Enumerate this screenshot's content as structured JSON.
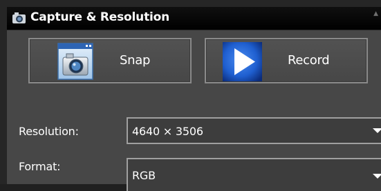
{
  "panel": {
    "title": "Capture & Resolution",
    "header_icon": "camera-icon",
    "scroll_indicator": "▲"
  },
  "buttons": {
    "snap": {
      "label": "Snap",
      "icon": "snapshot-window-camera-icon"
    },
    "record": {
      "label": "Record",
      "icon": "play-icon"
    }
  },
  "resolution": {
    "label": "Resolution:",
    "value": "4640 × 3506"
  },
  "format": {
    "label": "Format:",
    "value": "RGB"
  },
  "colors": {
    "panel_bg": "#474747",
    "header_bg": "#000000",
    "text": "#ffffff",
    "record_blue": "#1f5fd0"
  }
}
